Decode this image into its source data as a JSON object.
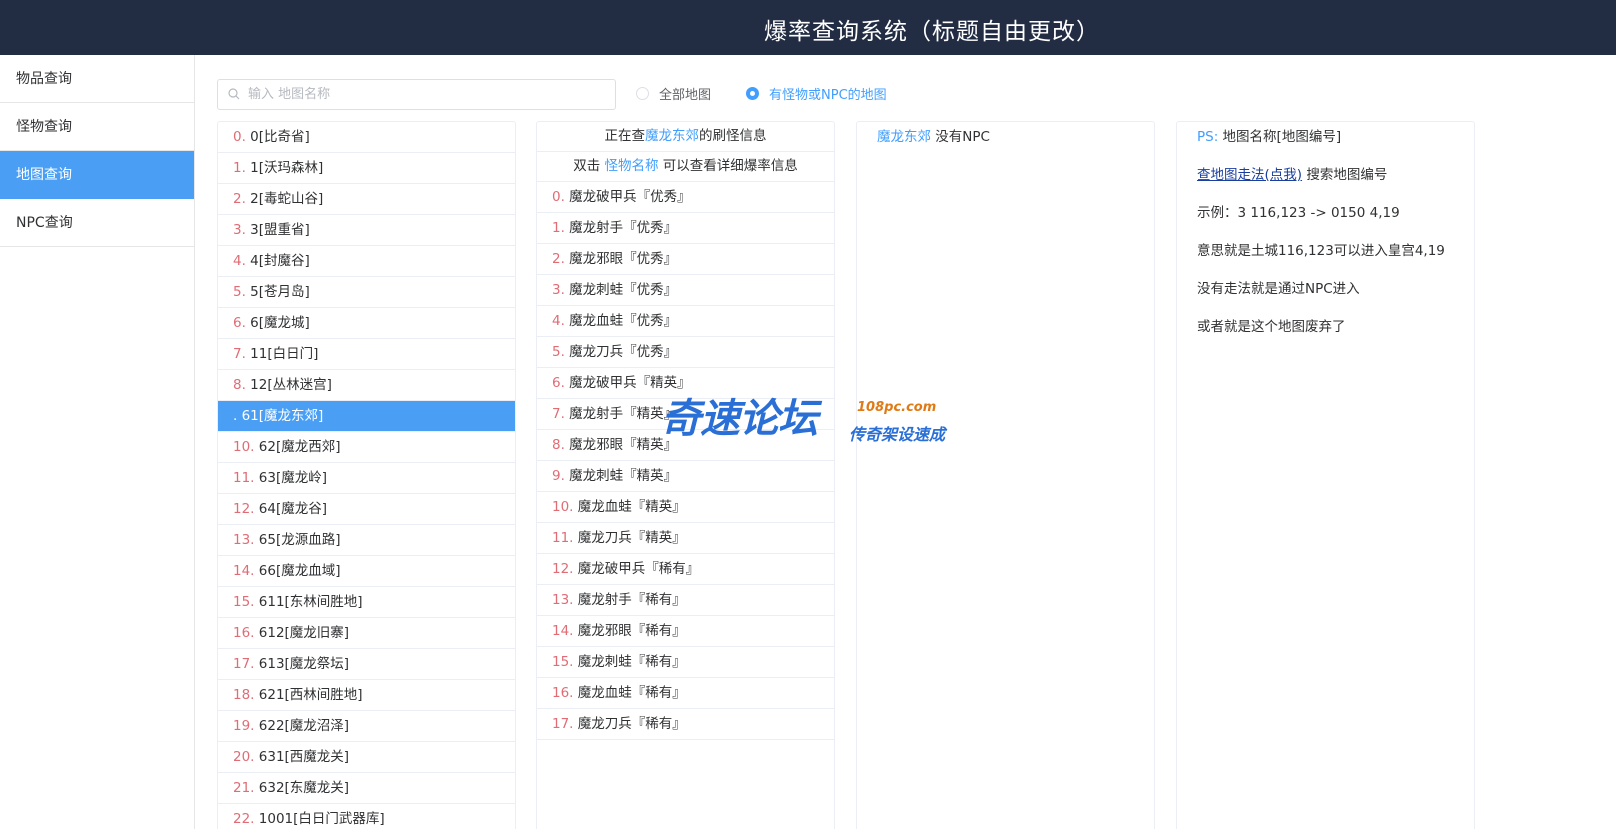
{
  "header": {
    "title": "爆率查询系统（标题自由更改）"
  },
  "sidebar": {
    "items": [
      {
        "label": "物品查询",
        "active": false
      },
      {
        "label": "怪物查询",
        "active": false
      },
      {
        "label": "地图查询",
        "active": true
      },
      {
        "label": "NPC查询",
        "active": false
      }
    ]
  },
  "search": {
    "placeholder": "输入 地图名称",
    "value": "",
    "icon": "search-icon"
  },
  "filters": {
    "all_maps": {
      "label": "全部地图",
      "checked": false
    },
    "with_monsters": {
      "label": "有怪物或NPC的地图",
      "checked": true
    }
  },
  "maps": [
    {
      "idx": "0.",
      "text": " 0[比奇省]"
    },
    {
      "idx": "1.",
      "text": " 1[沃玛森林]"
    },
    {
      "idx": "2.",
      "text": " 2[毒蛇山谷]"
    },
    {
      "idx": "3.",
      "text": " 3[盟重省]"
    },
    {
      "idx": "4.",
      "text": " 4[封魔谷]"
    },
    {
      "idx": "5.",
      "text": " 5[苍月岛]"
    },
    {
      "idx": "6.",
      "text": " 6[魔龙城]"
    },
    {
      "idx": "7.",
      "text": " 11[白日门]"
    },
    {
      "idx": "8.",
      "text": " 12[丛林迷宫]"
    },
    {
      "idx": ".",
      "text": " 61[魔龙东郊]",
      "active": true
    },
    {
      "idx": "10.",
      "text": " 62[魔龙西郊]"
    },
    {
      "idx": "11.",
      "text": " 63[魔龙岭]"
    },
    {
      "idx": "12.",
      "text": " 64[魔龙谷]"
    },
    {
      "idx": "13.",
      "text": " 65[龙源血路]"
    },
    {
      "idx": "14.",
      "text": " 66[魔龙血域]"
    },
    {
      "idx": "15.",
      "text": " 611[东林间胜地]"
    },
    {
      "idx": "16.",
      "text": " 612[魔龙旧寨]"
    },
    {
      "idx": "17.",
      "text": " 613[魔龙祭坛]"
    },
    {
      "idx": "18.",
      "text": " 621[西林间胜地]"
    },
    {
      "idx": "19.",
      "text": " 622[魔龙沼泽]"
    },
    {
      "idx": "20.",
      "text": " 631[西魔龙关]"
    },
    {
      "idx": "21.",
      "text": " 632[东魔龙关]"
    },
    {
      "idx": "22.",
      "text": " 1001[白日门武器库]"
    }
  ],
  "monster_panel": {
    "line1_prefix": "正在查",
    "map_name": "魔龙东郊",
    "line1_suffix": "的刷怪信息",
    "line2_prefix": "双击 ",
    "line2_highlight": "怪物名称",
    "line2_suffix": " 可以查看详细爆率信息",
    "monsters": [
      {
        "idx": "0.",
        "text": " 魔龙破甲兵『优秀』"
      },
      {
        "idx": "1.",
        "text": " 魔龙射手『优秀』"
      },
      {
        "idx": "2.",
        "text": " 魔龙邪眼『优秀』"
      },
      {
        "idx": "3.",
        "text": " 魔龙刺蛙『优秀』"
      },
      {
        "idx": "4.",
        "text": " 魔龙血蛙『优秀』"
      },
      {
        "idx": "5.",
        "text": " 魔龙刀兵『优秀』"
      },
      {
        "idx": "6.",
        "text": " 魔龙破甲兵『精英』"
      },
      {
        "idx": "7.",
        "text": " 魔龙射手『精英』"
      },
      {
        "idx": "8.",
        "text": " 魔龙邪眼『精英』"
      },
      {
        "idx": "9.",
        "text": " 魔龙刺蛙『精英』"
      },
      {
        "idx": "10.",
        "text": " 魔龙血蛙『精英』"
      },
      {
        "idx": "11.",
        "text": " 魔龙刀兵『精英』"
      },
      {
        "idx": "12.",
        "text": " 魔龙破甲兵『稀有』"
      },
      {
        "idx": "13.",
        "text": " 魔龙射手『稀有』"
      },
      {
        "idx": "14.",
        "text": " 魔龙邪眼『稀有』"
      },
      {
        "idx": "15.",
        "text": " 魔龙刺蛙『稀有』"
      },
      {
        "idx": "16.",
        "text": " 魔龙血蛙『稀有』"
      },
      {
        "idx": "17.",
        "text": " 魔龙刀兵『稀有』"
      }
    ]
  },
  "npc_panel": {
    "map_name": "魔龙东郊",
    "text": " 没有NPC"
  },
  "ps_panel": {
    "ps_label": "PS:",
    "ps_text": " 地图名称[地图编号]",
    "link_text": "查地图走法(点我)",
    "link_suffix": " 搜索地图编号",
    "example": "示例：3 116,123 -> 0150 4,19",
    "meaning": "意思就是土城116,123可以进入皇宫4,19",
    "no_path": "没有走法就是通过NPC进入",
    "abandoned": "或者就是这个地图废弃了"
  },
  "watermark": {
    "main": "奇速论坛",
    "url": "108pc.com",
    "sub": "传奇架设速成"
  },
  "colors": {
    "header_bg": "#222d44",
    "accent": "#4a9ff5",
    "link_blue": "#409eff",
    "index_red": "#e06c75"
  }
}
